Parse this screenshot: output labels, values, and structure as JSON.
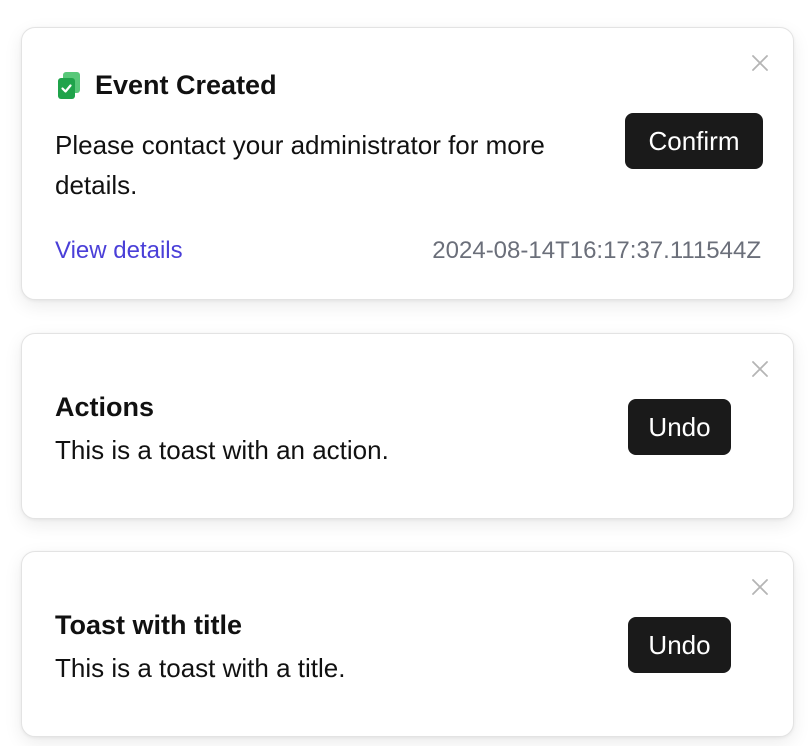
{
  "toasts": [
    {
      "icon": "clipboard-check-icon",
      "title": "Event Created",
      "description": "Please contact your administrator for more details.",
      "action_label": "Confirm",
      "link_label": "View details",
      "timestamp": "2024-08-14T16:17:37.111544Z"
    },
    {
      "title": "Actions",
      "description": "This is a toast with an action.",
      "action_label": "Undo"
    },
    {
      "title": "Toast with title",
      "description": "This is a toast with a title.",
      "action_label": "Undo"
    }
  ],
  "colors": {
    "accent_icon": "#22b14c",
    "link": "#4a3fd8",
    "button_bg": "#1a1a1a",
    "timestamp": "#6b6f7a"
  }
}
